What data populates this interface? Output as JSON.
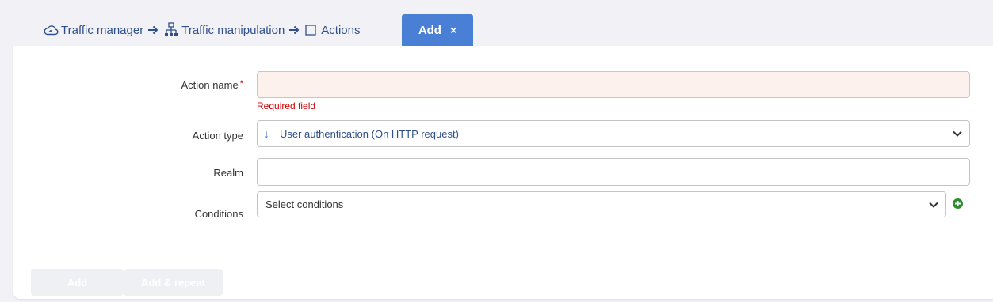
{
  "breadcrumb": {
    "items": [
      {
        "label": "Traffic manager",
        "icon": "cloud-icon"
      },
      {
        "label": "Traffic manipulation",
        "icon": "network-icon"
      },
      {
        "label": "Actions",
        "icon": "checkbox-icon"
      }
    ],
    "separator_icon": "arrow-right-icon"
  },
  "tab": {
    "label": "Add",
    "close_glyph": "×"
  },
  "form": {
    "action_name": {
      "label": "Action name",
      "required_mark": "*",
      "value": "",
      "error": "Required field"
    },
    "action_type": {
      "label": "Action type",
      "prefix_glyph": "↓",
      "value": "User authentication (On HTTP request)"
    },
    "realm": {
      "label": "Realm",
      "value": ""
    },
    "conditions": {
      "label": "Conditions",
      "value": "Select conditions"
    }
  },
  "buttons": {
    "add": "Add",
    "add_repeat": "Add & repeat"
  },
  "colors": {
    "accent": "#4a7fd6",
    "link": "#2f4f8a",
    "error": "#cc0000",
    "error_field_bg": "#fdf1ee",
    "add_icon": "#2e8b2e",
    "disabled_button": "#eef0f3"
  }
}
